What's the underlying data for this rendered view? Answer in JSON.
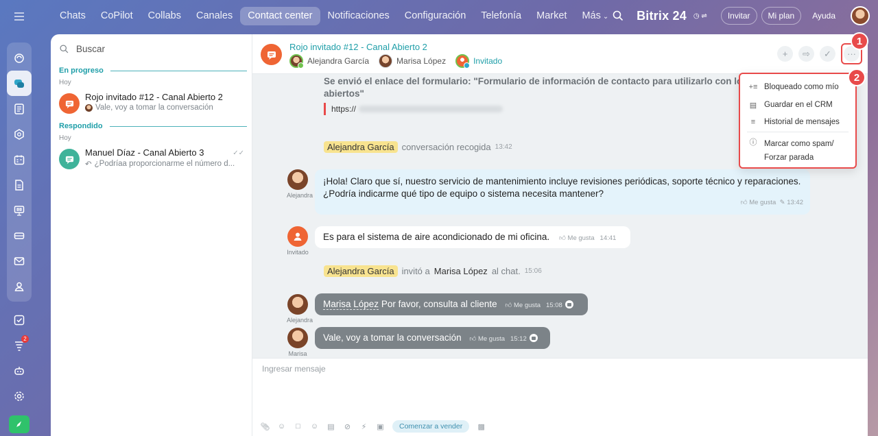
{
  "topnav": {
    "items": [
      "Chats",
      "CoPilot",
      "Collabs",
      "Canales",
      "Contact center",
      "Notificaciones",
      "Configuración",
      "Telefonía",
      "Market",
      "Más"
    ],
    "active_index": 4
  },
  "header_right": {
    "brand": "Bitrix 24",
    "invite": "Invitar",
    "plan": "Mi plan",
    "help": "Ayuda"
  },
  "rail": {
    "badge_count": "2"
  },
  "list": {
    "search_placeholder": "Buscar",
    "sections": [
      {
        "title": "En progreso",
        "day": "Hoy",
        "items": [
          {
            "title": "Rojo invitado #12 - Canal Abierto 2",
            "preview": "Vale, voy a tomar la conversación",
            "color": "#ef6534"
          }
        ]
      },
      {
        "title": "Respondido",
        "day": "Hoy",
        "items": [
          {
            "title": "Manuel Díaz - Canal Abierto 3",
            "preview": "¿Podríaa proporcionarme el número d...",
            "color": "#3fb39a"
          }
        ]
      }
    ]
  },
  "chat": {
    "title": "Rojo invitado #12 - Canal Abierto 2",
    "members": [
      "Alejandra García",
      "Marisa López",
      "Invitado"
    ],
    "callouts": [
      "1",
      "2"
    ],
    "system_form_text": "Se envió el enlace del formulario: \"Formulario de información de contacto para utilizarlo con los canales abiertos\"",
    "link_prefix": "https://",
    "events": [
      {
        "name": "Alejandra García",
        "text": "conversación recogida",
        "time": "13:42"
      },
      {
        "name": "Alejandra García",
        "text": "invitó a",
        "target": "Marisa López",
        "tail": "al chat.",
        "time": "15:06"
      }
    ],
    "messages": [
      {
        "author_label": "Alejandra",
        "text_line1": "¡Hola! Claro que sí, nuestro servicio de mantenimiento incluye revisiones periódicas, soporte técnico y reparaciones.",
        "text_line2": "¿Podría indicarme qué tipo de equipo o sistema necesita mantener?",
        "like": "Me gusta",
        "time": "13:42"
      },
      {
        "author_label": "Invitado",
        "text": "Es para el sistema de aire acondicionado de mi oficina.",
        "like": "Me gusta",
        "time": "14:41"
      },
      {
        "author_label": "Alejandra",
        "mention": "Marisa López",
        "text": "Por favor, consulta al cliente",
        "like": "Me gusta",
        "time": "15:08"
      },
      {
        "author_label": "Marisa",
        "text": "Vale, voy a tomar la conversación",
        "like": "Me gusta",
        "time": "15:12"
      }
    ],
    "menu": [
      {
        "label": "Bloqueado como mío",
        "icon": "pin-list-icon"
      },
      {
        "label": "Guardar en el CRM",
        "icon": "crm-card-icon"
      },
      {
        "label": "Historial de mensajes",
        "icon": "history-search-icon"
      },
      {
        "label_line1": "Marcar como spam/",
        "label_line2": "Forzar parada",
        "icon": "warning-circle-icon"
      }
    ],
    "input_placeholder": "Ingresar mensaje",
    "sell_button": "Comenzar a vender"
  },
  "colors": {
    "accent": "#1e9ea8",
    "highlight": "#e84a4a",
    "brand_orange": "#ef6534"
  }
}
